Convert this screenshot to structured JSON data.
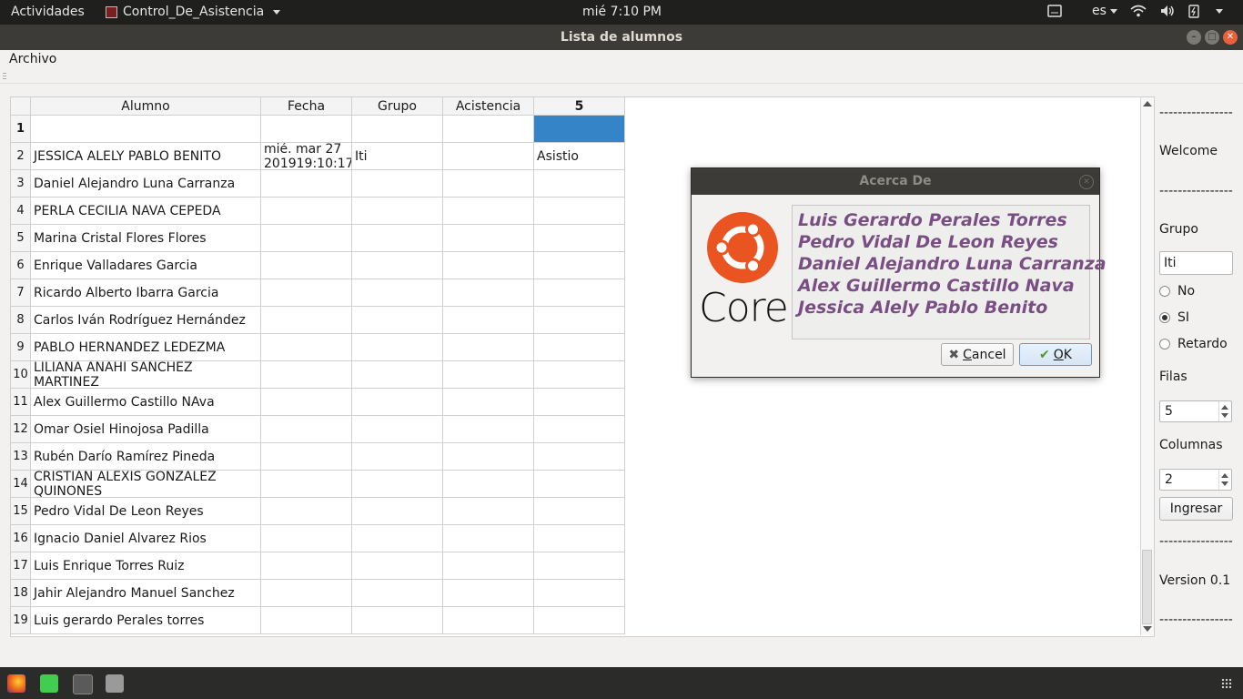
{
  "panel": {
    "activities": "Actividades",
    "app_name": "Control_De_Asistencia",
    "clock": "mié  7:10 PM",
    "lang": "es"
  },
  "window": {
    "title": "Lista de alumnos"
  },
  "menu": {
    "archivo": "Archivo"
  },
  "table": {
    "headers": [
      "Alumno",
      "Fecha",
      "Grupo",
      "Acistencia",
      "5"
    ],
    "rows": [
      {
        "num": "1",
        "alumno": "",
        "fecha": "",
        "grupo": "",
        "acist": "",
        "five": ""
      },
      {
        "num": "2",
        "alumno": "JESSICA ALELY PABLO BENITO",
        "fecha": "mié. mar 27 201919:10:17",
        "grupo": "Iti",
        "acist": "",
        "five": "Asistio"
      },
      {
        "num": "3",
        "alumno": "Daniel Alejandro Luna Carranza",
        "fecha": "",
        "grupo": "",
        "acist": "",
        "five": ""
      },
      {
        "num": "4",
        "alumno": "PERLA CECILIA NAVA CEPEDA",
        "fecha": "",
        "grupo": "",
        "acist": "",
        "five": ""
      },
      {
        "num": "5",
        "alumno": "Marina Cristal Flores Flores",
        "fecha": "",
        "grupo": "",
        "acist": "",
        "five": ""
      },
      {
        "num": "6",
        "alumno": "Enrique Valladares Garcia",
        "fecha": "",
        "grupo": "",
        "acist": "",
        "five": ""
      },
      {
        "num": "7",
        "alumno": "Ricardo Alberto Ibarra Garcia",
        "fecha": "",
        "grupo": "",
        "acist": "",
        "five": ""
      },
      {
        "num": "8",
        "alumno": "Carlos Iván Rodríguez Hernández",
        "fecha": "",
        "grupo": "",
        "acist": "",
        "five": ""
      },
      {
        "num": "9",
        "alumno": "PABLO HERNANDEZ LEDEZMA",
        "fecha": "",
        "grupo": "",
        "acist": "",
        "five": ""
      },
      {
        "num": "10",
        "alumno": "LILIANA ANAHI SANCHEZ MARTINEZ",
        "fecha": "",
        "grupo": "",
        "acist": "",
        "five": ""
      },
      {
        "num": "11",
        "alumno": "Alex Guillermo Castillo NAva",
        "fecha": "",
        "grupo": "",
        "acist": "",
        "five": ""
      },
      {
        "num": "12",
        "alumno": "Omar Osiel Hinojosa Padilla",
        "fecha": "",
        "grupo": "",
        "acist": "",
        "five": ""
      },
      {
        "num": "13",
        "alumno": "Rubén Darío Ramírez Pineda",
        "fecha": "",
        "grupo": "",
        "acist": "",
        "five": ""
      },
      {
        "num": "14",
        "alumno": "CRISTIAN ALEXIS GONZALEZ QUINONES",
        "fecha": "",
        "grupo": "",
        "acist": "",
        "five": ""
      },
      {
        "num": "15",
        "alumno": "Pedro Vidal De Leon Reyes",
        "fecha": "",
        "grupo": "",
        "acist": "",
        "five": ""
      },
      {
        "num": "16",
        "alumno": "Ignacio Daniel Alvarez Rios",
        "fecha": "",
        "grupo": "",
        "acist": "",
        "five": ""
      },
      {
        "num": "17",
        "alumno": "Luis Enrique Torres Ruiz",
        "fecha": "",
        "grupo": "",
        "acist": "",
        "five": ""
      },
      {
        "num": "18",
        "alumno": "Jahir Alejandro Manuel Sanchez",
        "fecha": "",
        "grupo": "",
        "acist": "",
        "five": ""
      },
      {
        "num": "19",
        "alumno": "Luis gerardo Perales torres",
        "fecha": "",
        "grupo": "",
        "acist": "",
        "five": ""
      }
    ]
  },
  "side": {
    "sep": "----------------",
    "welcome": "Welcome",
    "grupo_label": "Grupo",
    "grupo_value": "Iti",
    "radio_no": "No",
    "radio_si": "SI",
    "radio_retardo": "Retardo",
    "filas_label": "Filas",
    "filas_value": "5",
    "columnas_label": "Columnas",
    "columnas_value": "2",
    "ingresar": "Ingresar",
    "version": "Version 0.1"
  },
  "dialog": {
    "title": "Acerca De",
    "logo_word": "Core",
    "credits": [
      "Luis Gerardo Perales Torres",
      "Pedro Vidal De Leon Reyes",
      "Daniel Alejandro Luna Carranza",
      "Alex Guillermo Castillo Nava",
      "Jessica Alely Pablo Benito"
    ],
    "cancel_prefix": "",
    "cancel_u": "C",
    "cancel_rest": "ancel",
    "ok_u": "O",
    "ok_rest": "K"
  },
  "colors": {
    "accent": "#3584c8",
    "credits_text": "#7a4e84",
    "ubuntu_orange": "#e95420"
  }
}
